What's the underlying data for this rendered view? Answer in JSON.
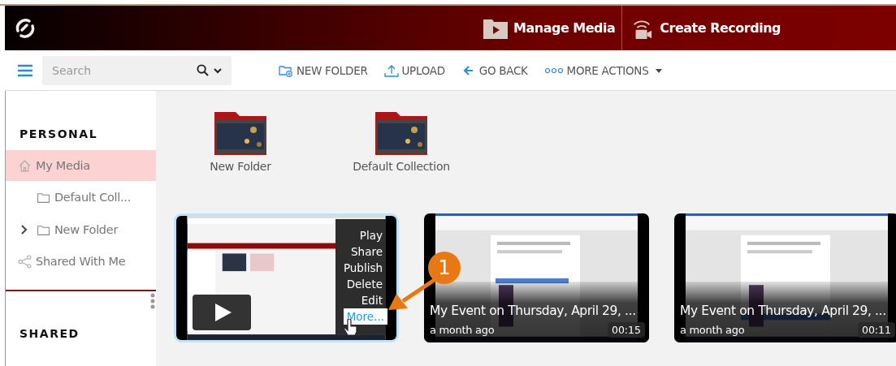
{
  "header": {
    "actions": [
      {
        "label": "Manage Media",
        "kind": "media"
      },
      {
        "label": "Create Recording",
        "kind": "record"
      }
    ]
  },
  "toolbar": {
    "search": {
      "placeholder": "Search"
    },
    "actions": [
      {
        "label": "NEW FOLDER",
        "kind": "folder"
      },
      {
        "label": "UPLOAD",
        "kind": "upload"
      },
      {
        "label": "GO BACK",
        "kind": "back"
      },
      {
        "label": "MORE ACTIONS",
        "kind": "more"
      }
    ]
  },
  "sidebar": {
    "sections": [
      {
        "title": "PERSONAL",
        "items": [
          {
            "label": "My Media",
            "kind": "home",
            "selected": true,
            "children": [
              {
                "label": "Default Coll...",
                "kind": "folder",
                "selected": false
              },
              {
                "label": "New Folder",
                "kind": "folder",
                "selected": false,
                "expanded": false
              }
            ]
          },
          {
            "label": "Shared With Me",
            "kind": "shared",
            "selected": false
          }
        ]
      },
      {
        "title": "SHARED"
      }
    ]
  },
  "folders": [
    {
      "label": "New Folder"
    },
    {
      "label": "Default Collection"
    }
  ],
  "media": [
    {
      "selected": true,
      "menu": [
        {
          "label": "Play",
          "selected": false
        },
        {
          "label": "Share",
          "selected": false
        },
        {
          "label": "Publish",
          "selected": false
        },
        {
          "label": "Delete",
          "selected": false
        },
        {
          "label": "Edit",
          "selected": false
        },
        {
          "label": "More...",
          "selected": true
        }
      ]
    },
    {
      "selected": false,
      "title": "My Event on Thursday, April 29, ...",
      "age": "a month ago",
      "duration": "00:15"
    },
    {
      "selected": false,
      "title": "My Event on Thursday, April 29, ...",
      "age": "a month ago",
      "duration": "00:11"
    }
  ],
  "annotation": {
    "label": "1"
  }
}
